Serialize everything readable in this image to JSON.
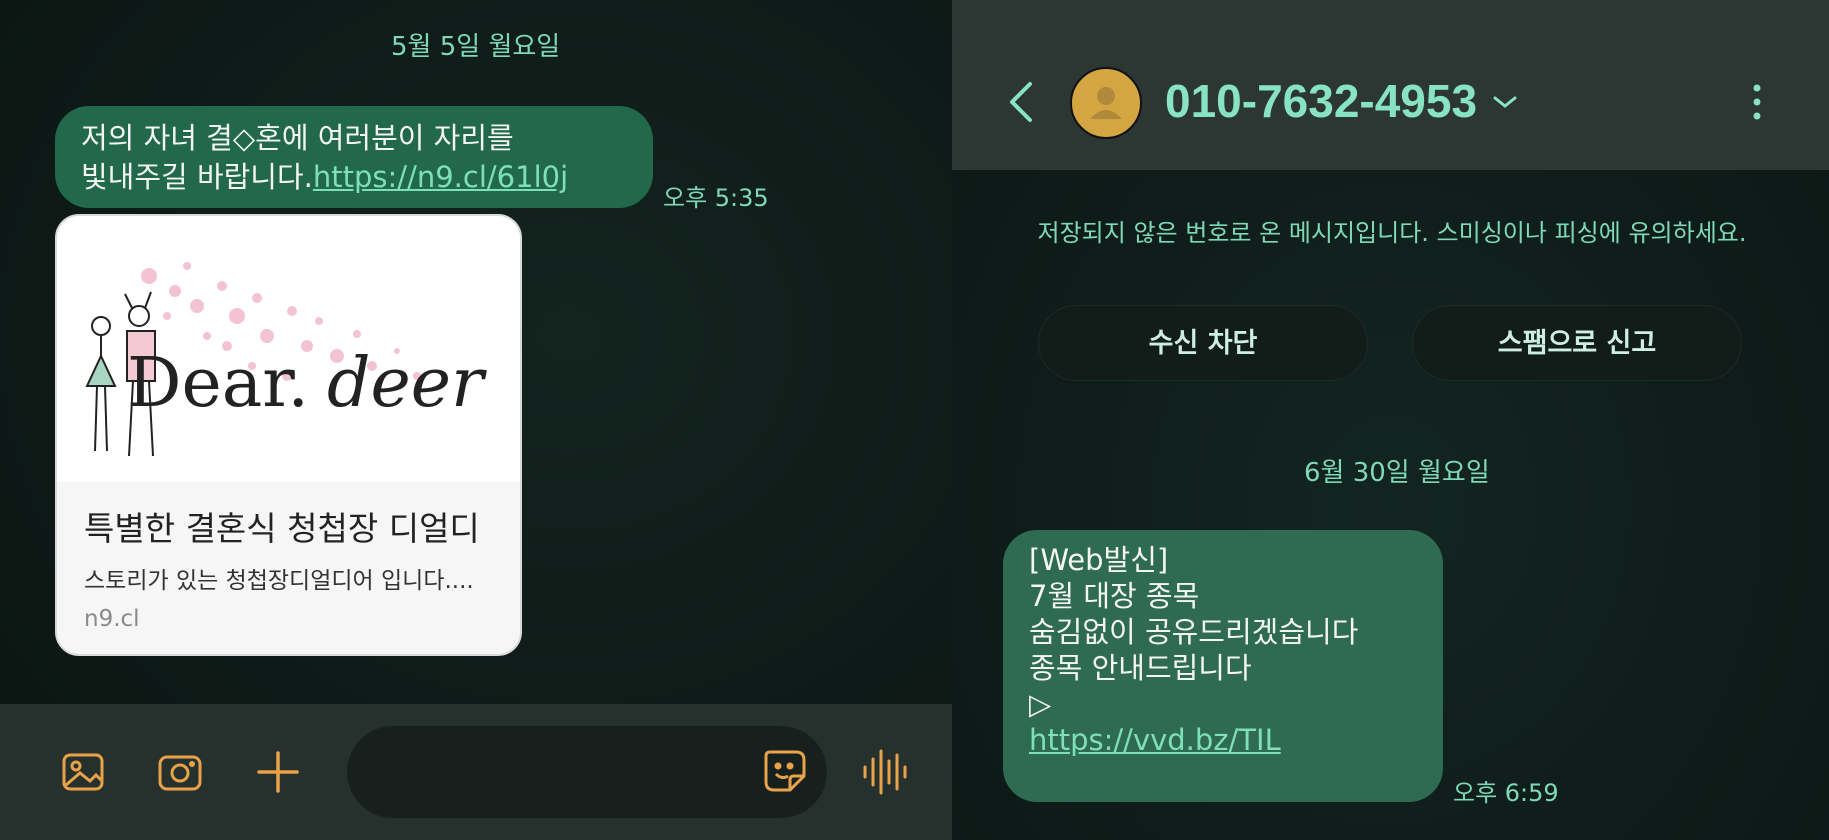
{
  "left": {
    "date_label": "5월 5일 월요일",
    "message": {
      "text_line1": "저의 자녀 결◇혼에 여러분이 자리를",
      "text_line2": "빛내주길 바랍니다.",
      "link": "https://n9.cl/61l0j",
      "time": "오후 5:35"
    },
    "preview": {
      "image_logo_text": "Dear.deer",
      "title": "특별한 결혼식 청첩장 디얼디",
      "description": "스토리가 있는 청첩장디얼디어 입니다....",
      "domain": "n9.cl"
    },
    "bottom_bar": {
      "icons": [
        "gallery-icon",
        "camera-icon",
        "plus-icon",
        "sticker-icon",
        "voice-icon"
      ]
    }
  },
  "right": {
    "header": {
      "phone_number": "010-7632-4953"
    },
    "warning": "저장되지 않은 번호로 온 메시지입니다. 스미싱이나 피싱에 유의하세요.",
    "actions": {
      "block": "수신 차단",
      "report": "스팸으로 신고"
    },
    "date_label": "6월 30일 월요일",
    "message": {
      "lines": [
        "[Web발신]",
        "7월 대장 종목",
        "숨김없이 공유드리겠습니다",
        "종목 안내드립니다",
        "▷"
      ],
      "link": "https://vvd.bz/TIL",
      "time": "오후 6:59"
    }
  },
  "colors": {
    "accent": "#7fd9b6",
    "bubble": "#22684b",
    "icon_orange": "#e8a24a"
  }
}
